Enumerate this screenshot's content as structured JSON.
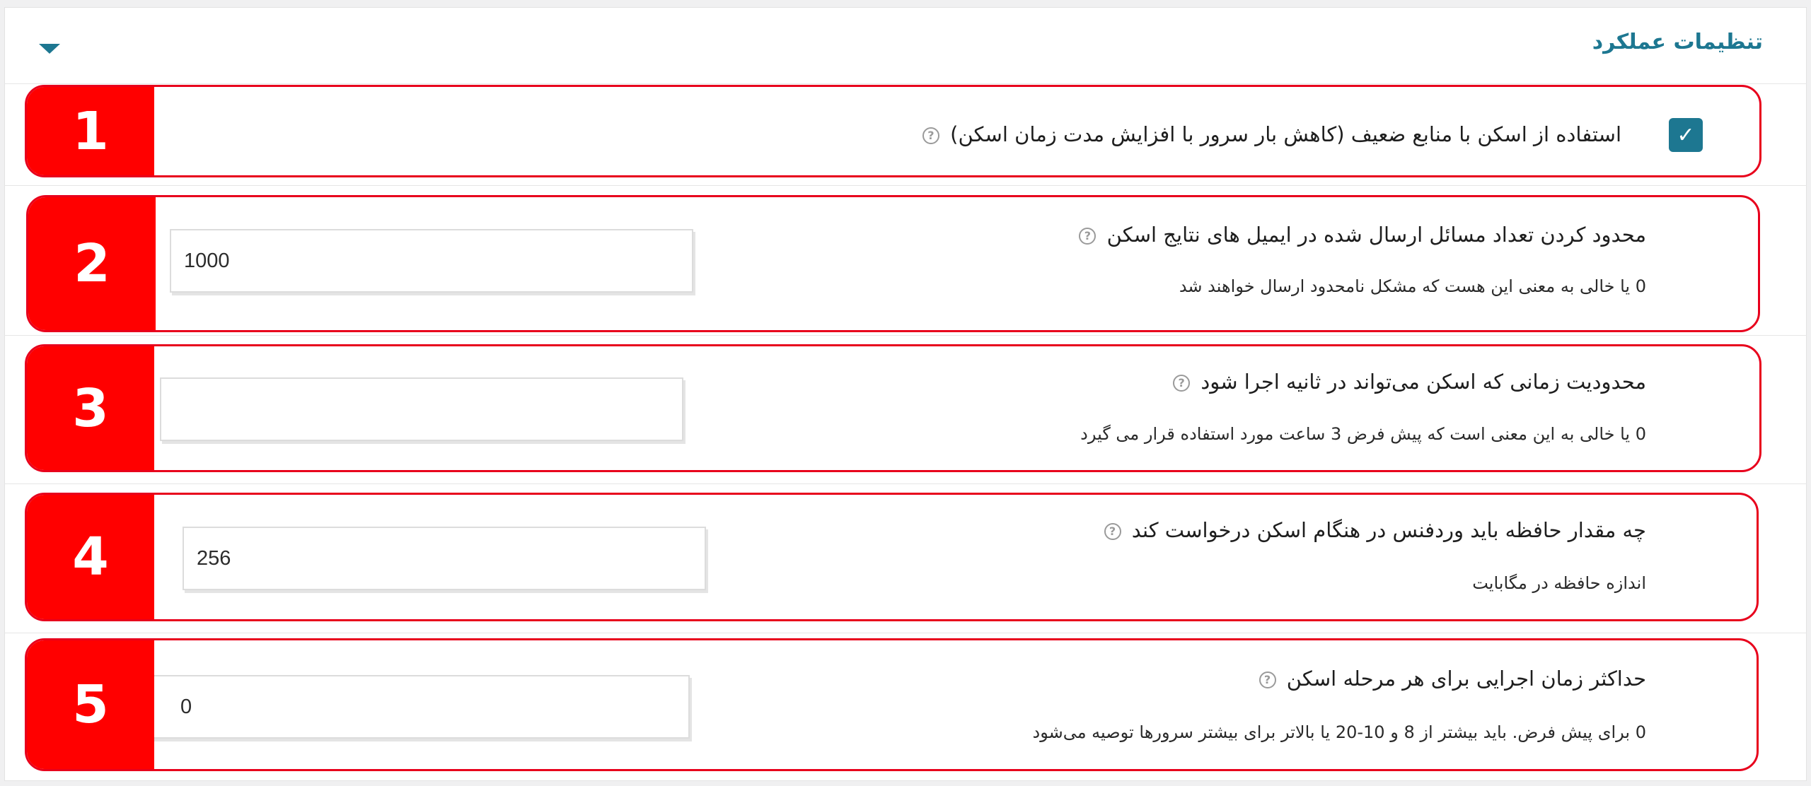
{
  "panel": {
    "title": "تنظیمات عملکرد",
    "toggle_icon": "caret-down-icon",
    "accent_color": "#1d7791",
    "highlight_color": "#ff0000"
  },
  "rows": [
    {
      "badge": "1",
      "label": "استفاده از اسکن با منابع ضعیف (کاهش بار سرور با افزایش مدت زمان اسکن)",
      "control": "checkbox",
      "checked": true
    },
    {
      "badge": "2",
      "label": "محدود کردن تعداد مسائل ارسال شده در ایمیل های نتایج اسکن",
      "value": "1000",
      "description": "0 یا خالی به معنی این هست که مشکل نامحدود ارسال خواهند شد"
    },
    {
      "badge": "3",
      "label": "محدودیت زمانی که اسکن می‌تواند در ثانیه اجرا شود",
      "value": "",
      "description": "0 یا خالی به این معنی است که پیش فرض 3 ساعت مورد استفاده قرار می گیرد"
    },
    {
      "badge": "4",
      "label": "چه مقدار حافظه باید وردفنس در هنگام اسکن درخواست کند",
      "value": "256",
      "description": "اندازه حافظه در مگابایت"
    },
    {
      "badge": "5",
      "label": "حداکثر زمان اجرایی برای هر مرحله اسکن",
      "value": "0",
      "description": "0 برای پیش فرض. باید بیشتر از 8 و 10-20 یا بالاتر برای بیشتر سرورها توصیه می‌شود"
    }
  ]
}
